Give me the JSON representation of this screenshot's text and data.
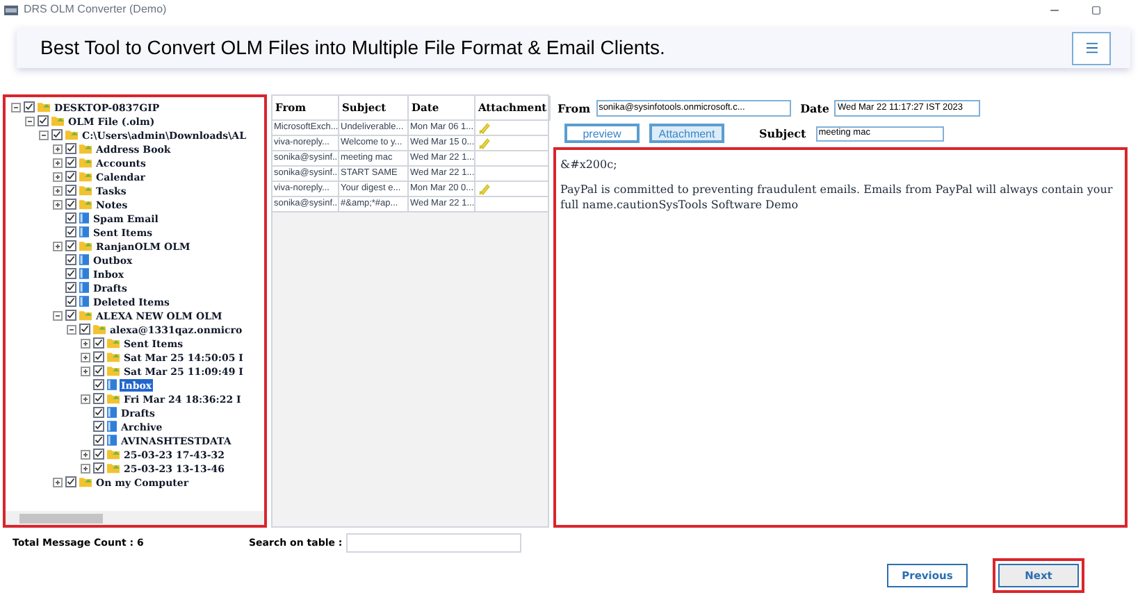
{
  "window": {
    "title": "DRS OLM Converter (Demo)"
  },
  "banner": {
    "headline": "Best Tool to Convert OLM Files into Multiple File Format & Email Clients."
  },
  "tree": [
    {
      "label": "DESKTOP-0837GIP",
      "kind": "folder",
      "checked": true,
      "expanded": true,
      "selected": false,
      "children": [
        {
          "label": "OLM File (.olm)",
          "kind": "folder",
          "checked": true,
          "expanded": true,
          "selected": false,
          "children": [
            {
              "label": "C:\\Users\\admin\\Downloads\\AL",
              "kind": "folder",
              "checked": true,
              "expanded": true,
              "selected": false,
              "children": [
                {
                  "label": "Address Book",
                  "kind": "folder",
                  "checked": true,
                  "expanded": false,
                  "selected": false
                },
                {
                  "label": "Accounts",
                  "kind": "folder",
                  "checked": true,
                  "expanded": false,
                  "selected": false
                },
                {
                  "label": "Calendar",
                  "kind": "folder",
                  "checked": true,
                  "expanded": false,
                  "selected": false
                },
                {
                  "label": "Tasks",
                  "kind": "folder",
                  "checked": true,
                  "expanded": false,
                  "selected": false
                },
                {
                  "label": "Notes",
                  "kind": "folder",
                  "checked": true,
                  "expanded": false,
                  "selected": false
                },
                {
                  "label": "Spam Email",
                  "kind": "file",
                  "checked": true,
                  "selected": false
                },
                {
                  "label": "Sent Items",
                  "kind": "file",
                  "checked": true,
                  "selected": false
                },
                {
                  "label": "RanjanOLM OLM",
                  "kind": "folder",
                  "checked": true,
                  "expanded": false,
                  "selected": false
                },
                {
                  "label": "Outbox",
                  "kind": "file",
                  "checked": true,
                  "selected": false
                },
                {
                  "label": "Inbox",
                  "kind": "file",
                  "checked": true,
                  "selected": false
                },
                {
                  "label": "Drafts",
                  "kind": "file",
                  "checked": true,
                  "selected": false
                },
                {
                  "label": "Deleted Items",
                  "kind": "file",
                  "checked": true,
                  "selected": false
                },
                {
                  "label": "ALEXA NEW OLM OLM",
                  "kind": "folder",
                  "checked": true,
                  "expanded": true,
                  "selected": false,
                  "children": [
                    {
                      "label": "alexa@1331qaz.onmicro",
                      "kind": "folder",
                      "checked": true,
                      "expanded": true,
                      "selected": false,
                      "children": [
                        {
                          "label": "Sent Items",
                          "kind": "folder",
                          "checked": true,
                          "expanded": false,
                          "selected": false
                        },
                        {
                          "label": "Sat Mar 25 14:50:05 I",
                          "kind": "folder",
                          "checked": true,
                          "expanded": false,
                          "selected": false
                        },
                        {
                          "label": "Sat Mar 25 11:09:49 I",
                          "kind": "folder",
                          "checked": true,
                          "expanded": false,
                          "selected": false
                        },
                        {
                          "label": "Inbox",
                          "kind": "file",
                          "checked": true,
                          "selected": true
                        },
                        {
                          "label": "Fri Mar 24 18:36:22 I",
                          "kind": "folder",
                          "checked": true,
                          "expanded": false,
                          "selected": false
                        },
                        {
                          "label": "Drafts",
                          "kind": "file",
                          "checked": true,
                          "selected": false
                        },
                        {
                          "label": "Archive",
                          "kind": "file",
                          "checked": true,
                          "selected": false
                        },
                        {
                          "label": "AVINASHTESTDATA",
                          "kind": "file",
                          "checked": true,
                          "selected": false
                        },
                        {
                          "label": "25-03-23 17-43-32",
                          "kind": "folder",
                          "checked": true,
                          "expanded": false,
                          "selected": false
                        },
                        {
                          "label": "25-03-23 13-13-46",
                          "kind": "folder",
                          "checked": true,
                          "expanded": false,
                          "selected": false
                        }
                      ]
                    }
                  ]
                },
                {
                  "label": "On my Computer",
                  "kind": "folder",
                  "checked": true,
                  "expanded": false,
                  "selected": false
                }
              ]
            }
          ]
        }
      ]
    }
  ],
  "table": {
    "columns": [
      "From",
      "Subject",
      "Date",
      "Attachment"
    ],
    "rows": [
      {
        "from": "MicrosoftExch...",
        "subject": "Undeliverable...",
        "date": "Mon Mar 06 1...",
        "attachment": true
      },
      {
        "from": "viva-noreply...",
        "subject": "Welcome to y...",
        "date": "Wed Mar 15 0...",
        "attachment": true
      },
      {
        "from": "sonika@sysinf...",
        "subject": "meeting mac",
        "date": "Wed Mar 22 1...",
        "attachment": false
      },
      {
        "from": "sonika@sysinf...",
        "subject": "START SAME",
        "date": "Wed Mar 22 1...",
        "attachment": false
      },
      {
        "from": "viva-noreply...",
        "subject": "Your digest e...",
        "date": "Mon Mar 20 0...",
        "attachment": true
      },
      {
        "from": "sonika@sysinf...",
        "subject": "#&amp;*#ap...",
        "date": "Wed Mar 22 1...",
        "attachment": false
      }
    ]
  },
  "message": {
    "from_label": "From",
    "from": "sonika@sysinfotools.onmicrosoft.c...",
    "date_label": "Date",
    "date": "Wed Mar 22 11:17:27 IST 2023",
    "preview_button": "preview",
    "attachment_button": "Attachment",
    "subject_label": "Subject",
    "subject": "meeting mac",
    "body": [
      "&#x200c;",
      "PayPal is committed to preventing fraudulent emails. Emails from PayPal will always contain your full name.cautionSysTools Software Demo"
    ]
  },
  "status_bar": {
    "count": "Total Message Count : 6",
    "search_label": "Search on table :"
  },
  "buttons": {
    "previous": "Previous",
    "next": "Next"
  }
}
